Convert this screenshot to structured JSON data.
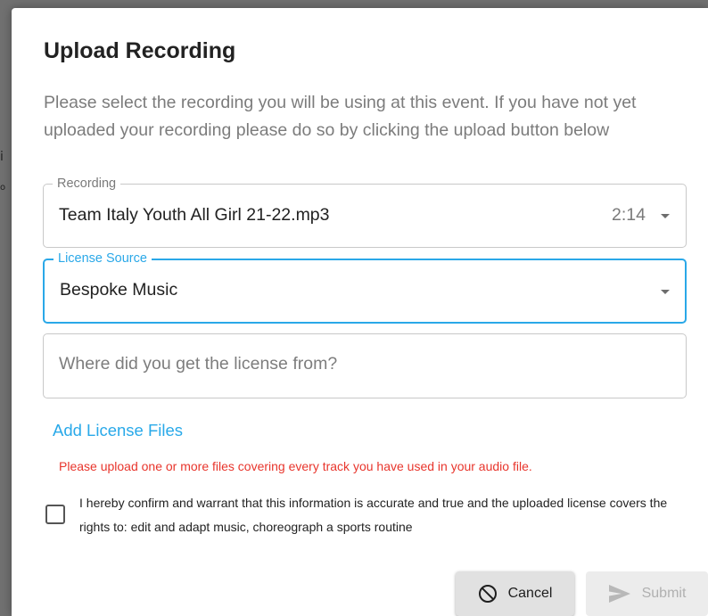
{
  "backdrop": {
    "glyph_a": "i",
    "glyph_b": "o"
  },
  "dialog": {
    "title": "Upload Recording",
    "description": "Please select the recording you will be using at this event. If you have not yet uploaded your recording please do so by clicking the upload button below"
  },
  "recording_field": {
    "label": "Recording",
    "value": "Team Italy Youth All Girl 21-22.mp3",
    "duration": "2:14",
    "icon": "chevron-down-icon"
  },
  "license_source_field": {
    "label": "License Source",
    "value": "Bespoke Music",
    "icon": "chevron-down-icon"
  },
  "license_origin_field": {
    "placeholder": "Where did you get the license from?",
    "value": ""
  },
  "add_license_files": {
    "label": "Add License Files"
  },
  "warning": {
    "text": "Please upload one or more files covering every track you have used in your audio file."
  },
  "confirmation": {
    "checked": false,
    "text": "I hereby confirm and warrant that this information is accurate and true and the uploaded license covers the rights to: edit and adapt music, choreograph a sports routine"
  },
  "actions": {
    "cancel_label": "Cancel",
    "cancel_icon": "block-icon",
    "submit_label": "Submit",
    "submit_icon": "send-icon"
  },
  "colors": {
    "accent": "#2aa8e8",
    "link": "#29a9e9",
    "error": "#e8352c",
    "disabled_text": "#b0b0b0"
  }
}
